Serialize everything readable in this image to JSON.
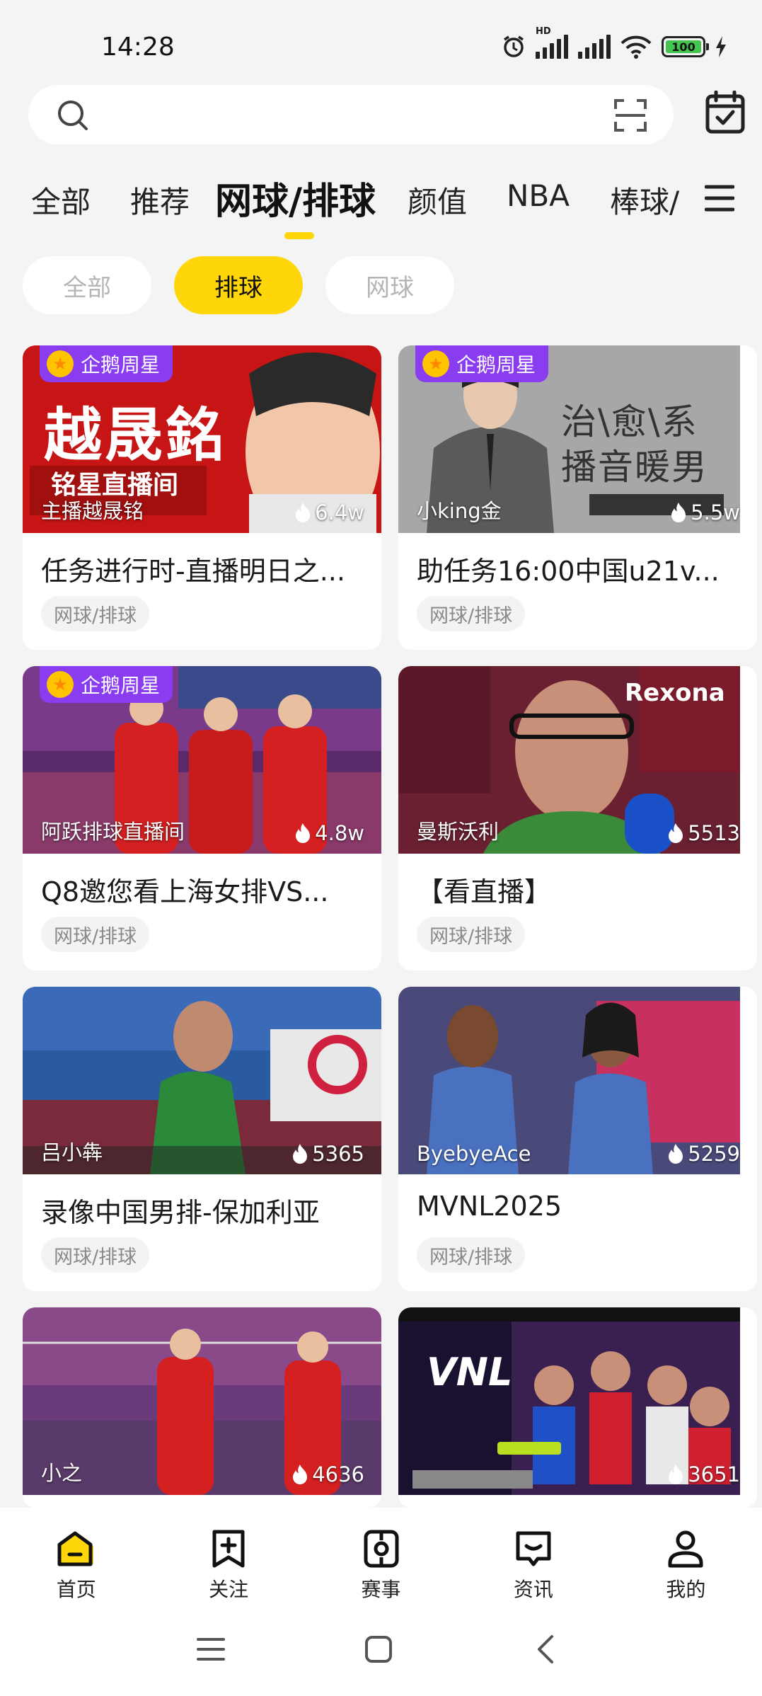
{
  "status_bar": {
    "time": "14:28",
    "battery": "100",
    "network_label": "HD"
  },
  "search": {
    "placeholder": ""
  },
  "tabs": [
    "全部",
    "推荐",
    "网球/排球",
    "颜值",
    "NBA",
    "棒球/"
  ],
  "active_tab": "网球/排球",
  "sub_filters": [
    "全部",
    "排球",
    "网球"
  ],
  "active_sub_filter": "排球",
  "cards": [
    {
      "badge": "企鹅周星",
      "owner": "主播越晟铭",
      "heat": "6.4w",
      "title": "任务进行时-直播明日之...",
      "tag": "网球/排球",
      "thumb_text": "越晟銘",
      "thumb_sub": "铭星直播间"
    },
    {
      "badge": "企鹅周星",
      "owner": "小king金",
      "heat": "5.5w",
      "title": "助任务16:00中国u21v...",
      "tag": "网球/排球",
      "thumb_text": "治\\愈\\系",
      "thumb_sub": "播音暖男"
    },
    {
      "badge": "企鹅周星",
      "owner": "阿跃排球直播间",
      "heat": "4.8w",
      "title": "Q8邀您看上海女排VS...",
      "tag": "网球/排球"
    },
    {
      "badge": "",
      "owner": "曼斯沃利",
      "heat": "5513",
      "title": "【看直播】",
      "tag": "网球/排球",
      "thumb_text": "Rexona"
    },
    {
      "badge": "",
      "owner": "吕小犇",
      "heat": "5365",
      "title": "录像中国男排-保加利亚",
      "tag": "网球/排球"
    },
    {
      "badge": "",
      "owner": "ByebyeAce",
      "heat": "5259",
      "title": "MVNL2025",
      "tag": "网球/排球"
    },
    {
      "badge": "",
      "owner": "小之",
      "heat": "4636",
      "title": "",
      "tag": ""
    },
    {
      "badge": "",
      "owner": "",
      "heat": "3651",
      "title": "",
      "tag": "",
      "thumb_text": "VNL"
    }
  ],
  "bottom_nav": [
    "首页",
    "关注",
    "赛事",
    "资讯",
    "我的"
  ],
  "colors": {
    "accent": "#ffd60a",
    "badge": "#8a3cf0",
    "background": "#f4f4f4"
  }
}
